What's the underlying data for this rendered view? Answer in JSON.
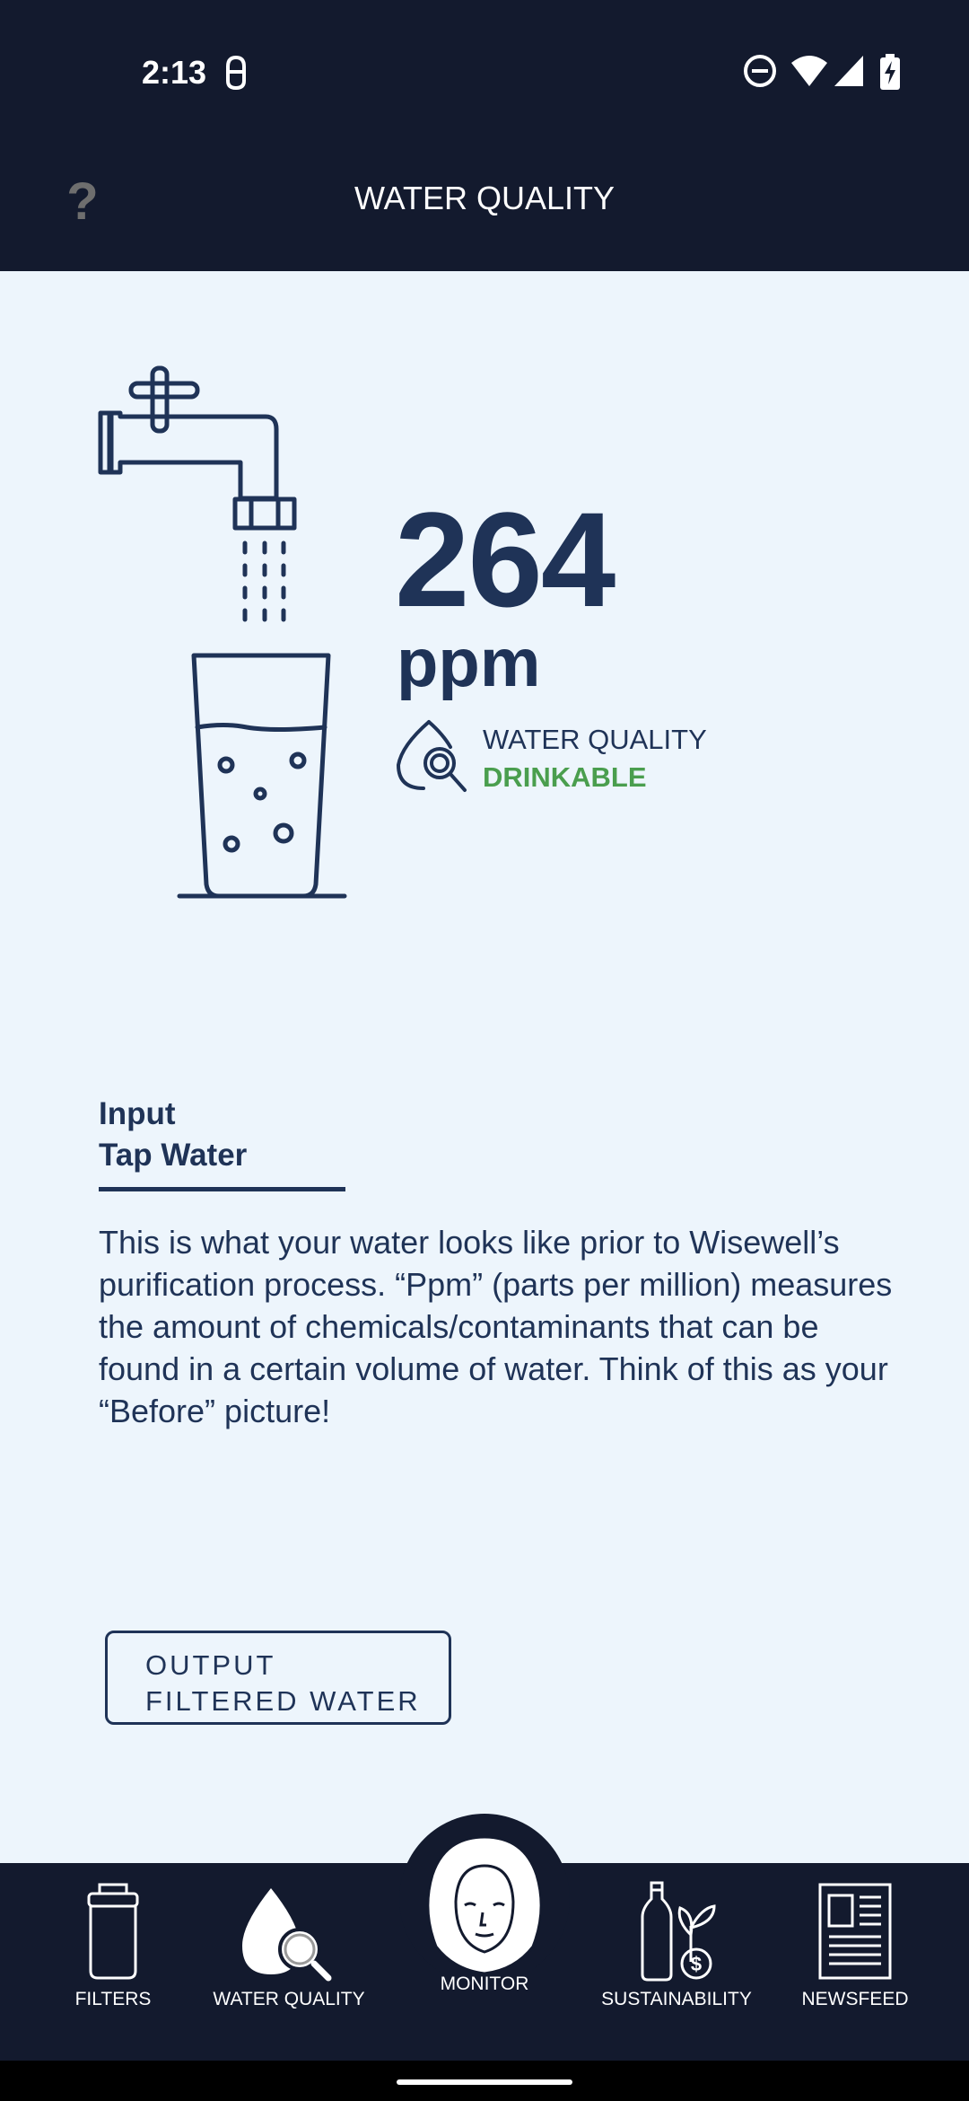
{
  "status_bar": {
    "time": "2:13"
  },
  "app_bar": {
    "title": "WATER QUALITY",
    "help_label": "?"
  },
  "reading": {
    "value": "264",
    "unit": "ppm",
    "quality_label": "WATER QUALITY",
    "quality_status": "DRINKABLE",
    "status_color": "#4a9e4e"
  },
  "input_section": {
    "heading_line1": "Input",
    "heading_line2": "Tap Water",
    "description": "This is what your water looks like prior to Wisewell’s purification process. “Ppm” (parts per million) measures the amount of chemicals/contaminants that can be found in a certain volume of water. Think of this as your “Before” picture!"
  },
  "output_button": {
    "line1": "OUTPUT",
    "line2": "FILTERED WATER"
  },
  "bottom_nav": {
    "items": [
      {
        "label": "FILTERS",
        "icon": "filter-cartridge-icon"
      },
      {
        "label": "WATER QUALITY",
        "icon": "water-drop-magnifier-icon"
      },
      {
        "label": "MONITOR",
        "icon": "face-avatar-icon"
      },
      {
        "label": "SUSTAINABILITY",
        "icon": "bottle-plant-dollar-icon"
      },
      {
        "label": "NEWSFEED",
        "icon": "newspaper-icon"
      }
    ]
  },
  "colors": {
    "dark_navy": "#131a2e",
    "text_navy": "#1f3357",
    "background": "#edf5fc",
    "accent_green": "#4a9e4e"
  }
}
